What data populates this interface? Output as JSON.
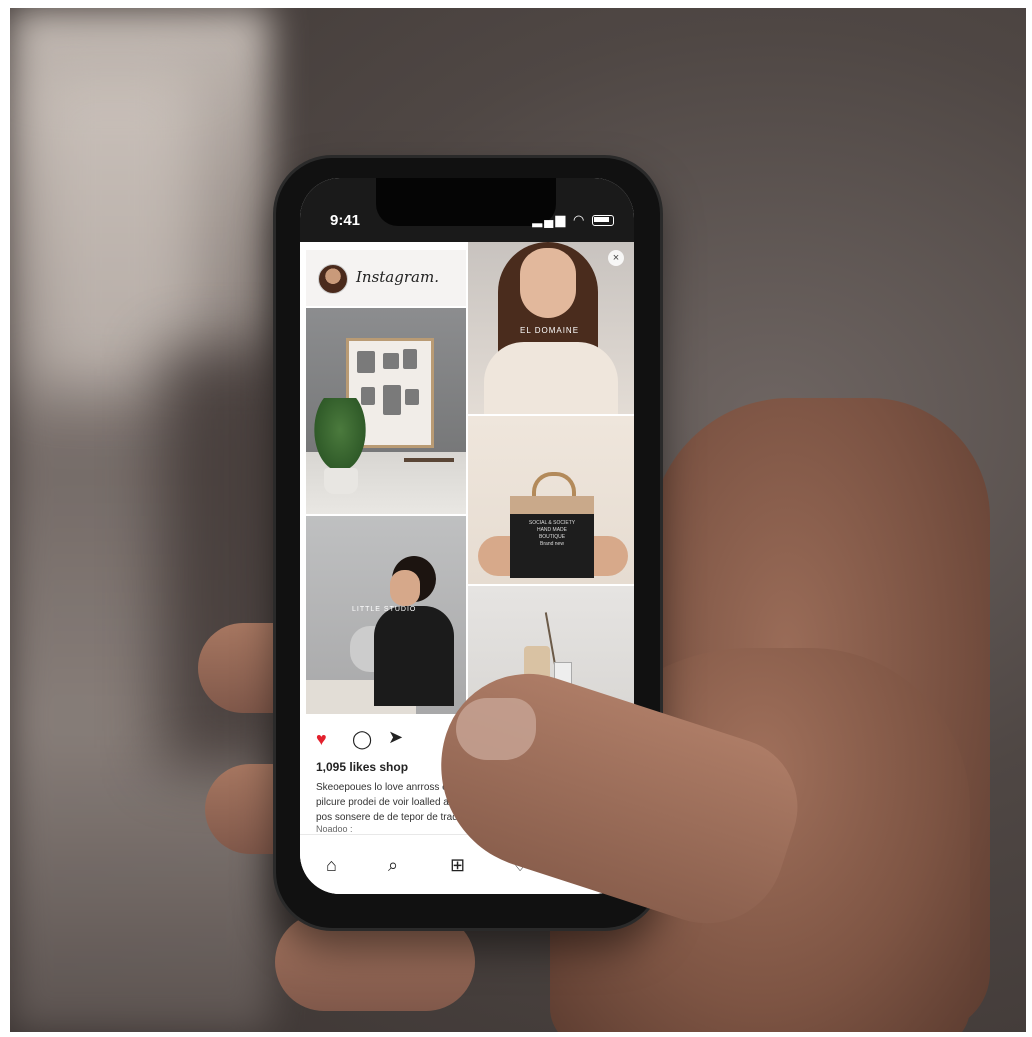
{
  "status_bar": {
    "time": "9:41"
  },
  "app": {
    "brand": "Instagram."
  },
  "posts": {
    "tile_brand_text": "EL DOMAINE",
    "tile_sign_text": "LITTLE STUDIO",
    "bag_text": "SOCIAL & SOCIETY\nHAND MADE\nBOUTIQUE\nBrand new"
  },
  "feed": {
    "likes": "1,095 likes shop",
    "caption": "Skeoepoues lo love anrross es do amo the pilcure prodei de voir loalled a memee, fre bira pos sonsere de de tepor de trads.",
    "more": "Noadoo :"
  },
  "icons": {
    "like": "heart-filled-icon",
    "comment": "comment-icon",
    "share": "send-icon",
    "home": "home-icon",
    "search": "search-icon",
    "add": "add-icon",
    "activity": "heart-icon",
    "profile": "profile-icon"
  },
  "colors": {
    "like": "#e3212d",
    "phone": "#111111"
  }
}
